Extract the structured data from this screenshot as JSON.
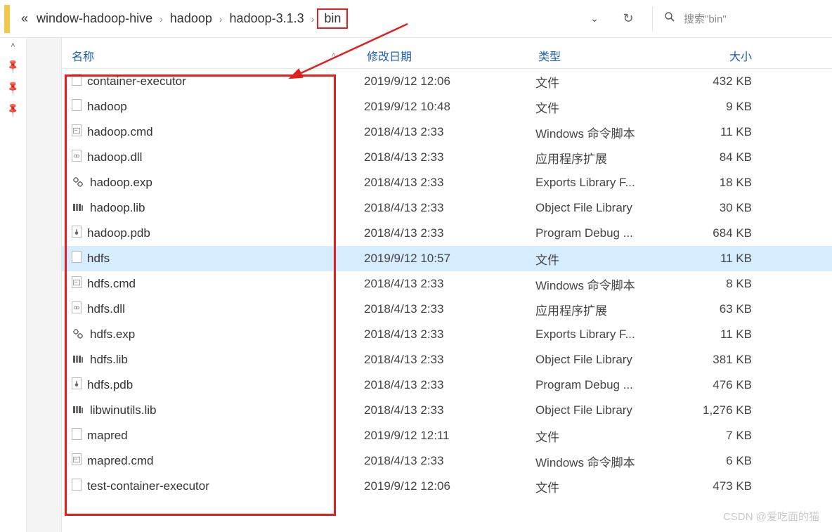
{
  "breadcrumb": {
    "prefix": "«",
    "parts": [
      "window-hadoop-hive",
      "hadoop",
      "hadoop-3.1.3",
      "bin"
    ]
  },
  "search": {
    "placeholder": "搜索\"bin\""
  },
  "headers": {
    "name": "名称",
    "date": "修改日期",
    "type": "类型",
    "size": "大小"
  },
  "files": [
    {
      "icon": "file",
      "name": "container-executor",
      "date": "2019/9/12 12:06",
      "type": "文件",
      "size": "432 KB"
    },
    {
      "icon": "file",
      "name": "hadoop",
      "date": "2019/9/12 10:48",
      "type": "文件",
      "size": "9 KB"
    },
    {
      "icon": "cmd",
      "name": "hadoop.cmd",
      "date": "2018/4/13 2:33",
      "type": "Windows 命令脚本",
      "size": "11 KB"
    },
    {
      "icon": "dll",
      "name": "hadoop.dll",
      "date": "2018/4/13 2:33",
      "type": "应用程序扩展",
      "size": "84 KB"
    },
    {
      "icon": "exp",
      "name": "hadoop.exp",
      "date": "2018/4/13 2:33",
      "type": "Exports Library F...",
      "size": "18 KB"
    },
    {
      "icon": "lib",
      "name": "hadoop.lib",
      "date": "2018/4/13 2:33",
      "type": "Object File Library",
      "size": "30 KB"
    },
    {
      "icon": "pdb",
      "name": "hadoop.pdb",
      "date": "2018/4/13 2:33",
      "type": "Program Debug ...",
      "size": "684 KB"
    },
    {
      "icon": "file",
      "name": "hdfs",
      "date": "2019/9/12 10:57",
      "type": "文件",
      "size": "11 KB",
      "selected": true
    },
    {
      "icon": "cmd",
      "name": "hdfs.cmd",
      "date": "2018/4/13 2:33",
      "type": "Windows 命令脚本",
      "size": "8 KB"
    },
    {
      "icon": "dll",
      "name": "hdfs.dll",
      "date": "2018/4/13 2:33",
      "type": "应用程序扩展",
      "size": "63 KB"
    },
    {
      "icon": "exp",
      "name": "hdfs.exp",
      "date": "2018/4/13 2:33",
      "type": "Exports Library F...",
      "size": "11 KB"
    },
    {
      "icon": "lib",
      "name": "hdfs.lib",
      "date": "2018/4/13 2:33",
      "type": "Object File Library",
      "size": "381 KB"
    },
    {
      "icon": "pdb",
      "name": "hdfs.pdb",
      "date": "2018/4/13 2:33",
      "type": "Program Debug ...",
      "size": "476 KB"
    },
    {
      "icon": "lib",
      "name": "libwinutils.lib",
      "date": "2018/4/13 2:33",
      "type": "Object File Library",
      "size": "1,276 KB"
    },
    {
      "icon": "file",
      "name": "mapred",
      "date": "2019/9/12 12:11",
      "type": "文件",
      "size": "7 KB"
    },
    {
      "icon": "cmd",
      "name": "mapred.cmd",
      "date": "2018/4/13 2:33",
      "type": "Windows 命令脚本",
      "size": "6 KB"
    },
    {
      "icon": "file",
      "name": "test-container-executor",
      "date": "2019/9/12 12:06",
      "type": "文件",
      "size": "473 KB"
    }
  ],
  "watermark": "CSDN @爱吃面的猫"
}
